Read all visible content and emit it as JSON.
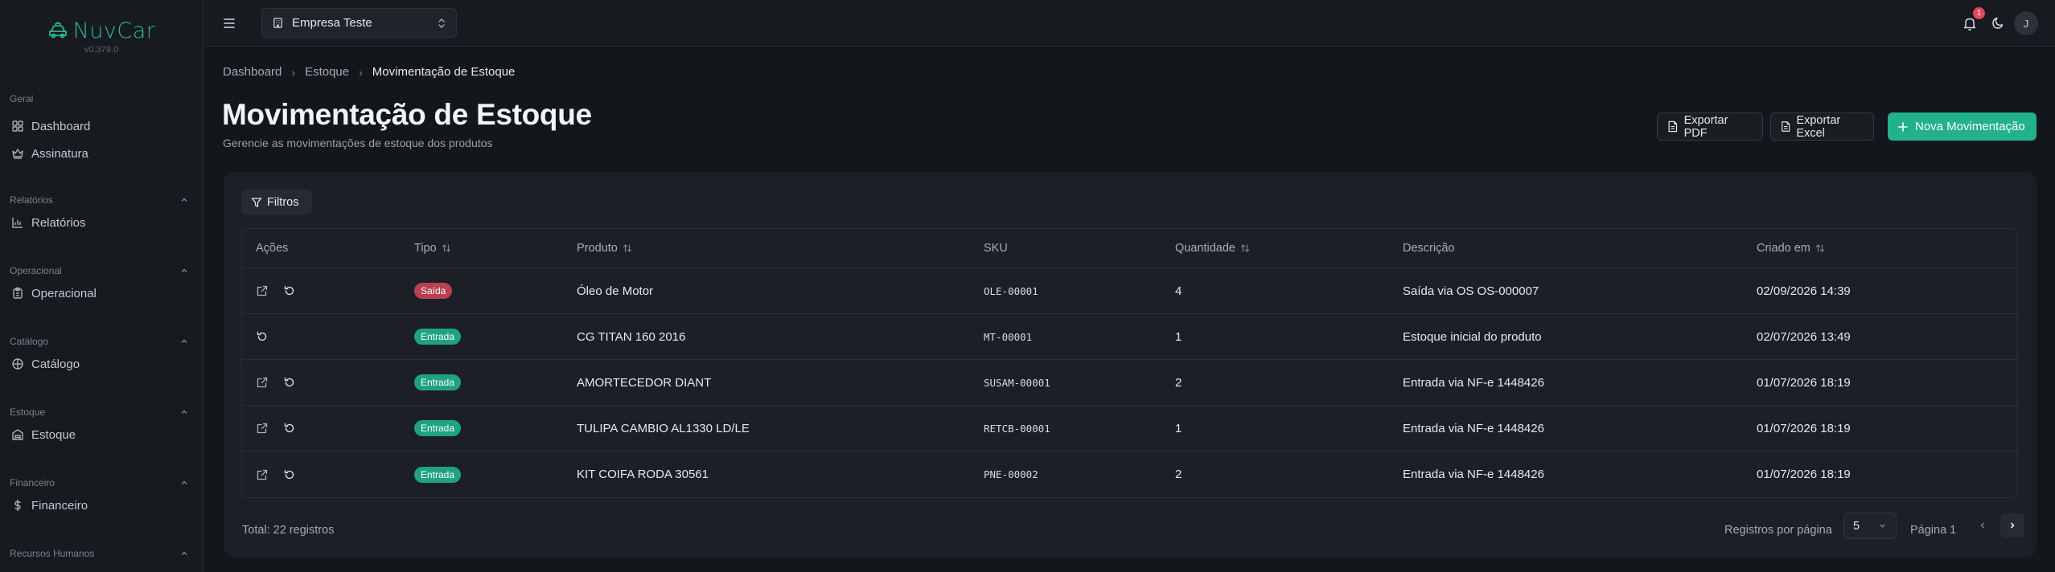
{
  "app": {
    "brand_name": "NuvCar",
    "version": "v0.379.0",
    "brand_color": "#2bb991"
  },
  "sidebar": {
    "groups": [
      {
        "label": "Geral",
        "collapsible": false,
        "items": [
          {
            "label": "Dashboard",
            "icon": "dashboard-icon"
          },
          {
            "label": "Assinatura",
            "icon": "crown-icon"
          }
        ]
      },
      {
        "label": "Relatórios",
        "collapsible": true,
        "items": [
          {
            "label": "Relatórios",
            "icon": "bar-chart-icon"
          }
        ]
      },
      {
        "label": "Operacional",
        "collapsible": true,
        "items": [
          {
            "label": "Operacional",
            "icon": "clipboard-icon"
          }
        ]
      },
      {
        "label": "Catálogo",
        "collapsible": true,
        "items": [
          {
            "label": "Catálogo",
            "icon": "package-icon"
          }
        ]
      },
      {
        "label": "Estoque",
        "collapsible": true,
        "items": [
          {
            "label": "Estoque",
            "icon": "warehouse-icon"
          }
        ]
      },
      {
        "label": "Financeiro",
        "collapsible": true,
        "items": [
          {
            "label": "Financeiro",
            "icon": "dollar-icon"
          }
        ]
      },
      {
        "label": "Recursos Humanos",
        "collapsible": true,
        "items": []
      }
    ]
  },
  "topbar": {
    "company_name": "Empresa Teste",
    "notification_count": "1",
    "avatar_initial": "J"
  },
  "breadcrumb": [
    "Dashboard",
    "Estoque",
    "Movimentação de Estoque"
  ],
  "page": {
    "title": "Movimentação de Estoque",
    "subtitle": "Gerencie as movimentações de estoque dos produtos"
  },
  "actions": {
    "export_pdf": "Exportar PDF",
    "export_excel": "Exportar Excel",
    "new_movement": "Nova Movimentação"
  },
  "filters_label": "Filtros",
  "table": {
    "headers": {
      "acoes": "Ações",
      "tipo": "Tipo",
      "produto": "Produto",
      "sku": "SKU",
      "quantidade": "Quantidade",
      "descricao": "Descrição",
      "criado_em": "Criado em"
    },
    "rows": [
      {
        "tipo": "Saída",
        "produto": "Óleo de Motor",
        "sku": "OLE-00001",
        "quantidade": "4",
        "descricao": "Saída via OS OS-000007",
        "criado_em": "02/09/2026 14:39",
        "has_link": true
      },
      {
        "tipo": "Entrada",
        "produto": "CG TITAN 160 2016",
        "sku": "MT-00001",
        "quantidade": "1",
        "descricao": "Estoque inicial do produto",
        "criado_em": "02/07/2026 13:49",
        "has_link": false
      },
      {
        "tipo": "Entrada",
        "produto": "AMORTECEDOR DIANT",
        "sku": "SUSAM-00001",
        "quantidade": "2",
        "descricao": "Entrada via NF-e 1448426",
        "criado_em": "01/07/2026 18:19",
        "has_link": true
      },
      {
        "tipo": "Entrada",
        "produto": "TULIPA CAMBIO AL1330 LD/LE",
        "sku": "RETCB-00001",
        "quantidade": "1",
        "descricao": "Entrada via NF-e 1448426",
        "criado_em": "01/07/2026 18:19",
        "has_link": true
      },
      {
        "tipo": "Entrada",
        "produto": "KIT COIFA RODA 30561",
        "sku": "PNE-00002",
        "quantidade": "2",
        "descricao": "Entrada via NF-e 1448426",
        "criado_em": "01/07/2026 18:19",
        "has_link": true
      }
    ]
  },
  "pagination": {
    "total": "Total: 22 registros",
    "per_page_label": "Registros por página",
    "per_page_value": "5",
    "page_label": "Página 1"
  },
  "colors": {
    "saida_badge": "#b8404f",
    "entrada_badge": "#1fa37f",
    "primary_button": "#22b08d"
  }
}
